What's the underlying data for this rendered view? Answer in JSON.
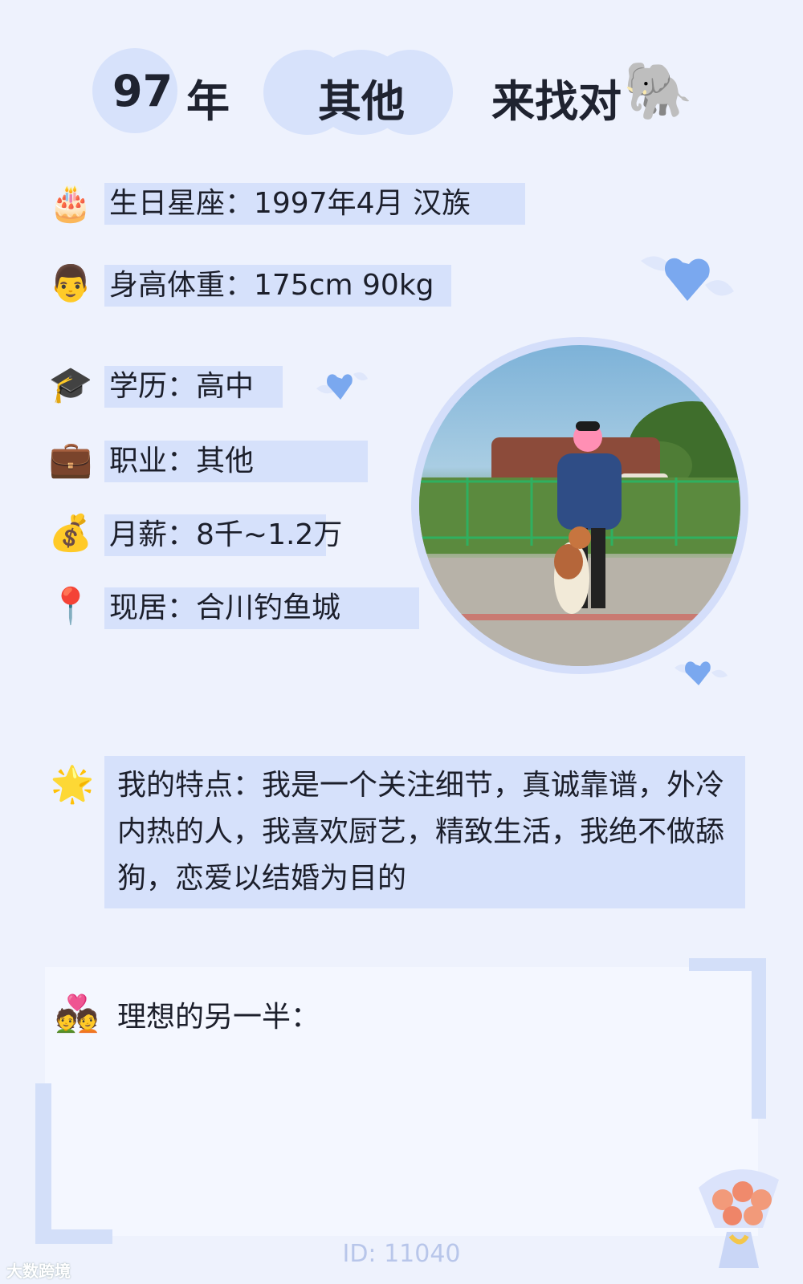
{
  "header": {
    "year_number": "97",
    "year_unit": "年",
    "occupation": "其他",
    "seeking_prefix": "来找对",
    "seeking_icon": "elephant-emoji"
  },
  "info_rows": [
    {
      "icon": "birthday-cake-icon",
      "glyph": "🎂",
      "text": "生日星座：1997年4月 汉族"
    },
    {
      "icon": "man-face-icon",
      "glyph": "👨",
      "text": "身高体重：175cm 90kg"
    },
    {
      "icon": "graduation-cap-icon",
      "glyph": "🎓",
      "text": "学历：高中"
    },
    {
      "icon": "briefcase-icon",
      "glyph": "💼",
      "text": "职业：其他"
    },
    {
      "icon": "money-bag-icon",
      "glyph": "💰",
      "text": "月薪：8千~1.2万"
    },
    {
      "icon": "location-pin-icon",
      "glyph": "📍",
      "text": "现居：合川钓鱼城"
    }
  ],
  "features": {
    "icon": "star-icon",
    "glyph": "🌟",
    "text": "我的特点：我是一个关注细节，真诚靠谱，外冷内热的人，我喜欢厨艺，精致生活，我绝不做舔狗，恋爱以结婚为目的"
  },
  "ideal_partner": {
    "icon": "couple-heart-icon",
    "glyph": "💑",
    "label": "理想的另一半："
  },
  "footer": {
    "id_text": "ID: 11040",
    "logo_text": "大数跨境"
  },
  "colors": {
    "background": "#eef2fd",
    "highlight": "#d6e1fb",
    "heart": "#7aa8ef",
    "text": "#1c1f2b"
  }
}
